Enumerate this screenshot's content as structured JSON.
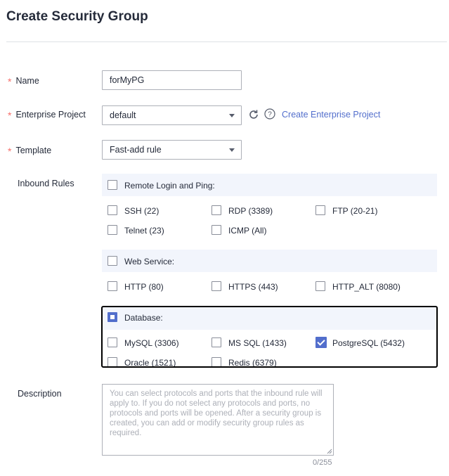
{
  "page": {
    "title": "Create Security Group"
  },
  "form": {
    "name": {
      "label": "Name",
      "value": "forMyPG"
    },
    "enterprise_project": {
      "label": "Enterprise Project",
      "value": "default",
      "create_link": "Create Enterprise Project"
    },
    "template": {
      "label": "Template",
      "value": "Fast-add rule"
    },
    "inbound_rules": {
      "label": "Inbound Rules",
      "remote_login": {
        "header": "Remote Login and Ping:",
        "options": [
          "SSH (22)",
          "RDP (3389)",
          "FTP (20-21)",
          "Telnet (23)",
          "ICMP (All)"
        ]
      },
      "web_service": {
        "header": "Web Service:",
        "options": [
          "HTTP (80)",
          "HTTPS (443)",
          "HTTP_ALT (8080)"
        ]
      },
      "database": {
        "header": "Database:",
        "state": "indeterminate",
        "options": [
          "MySQL (3306)",
          "MS SQL (1433)",
          "PostgreSQL (5432)",
          "Oracle (1521)",
          "Redis (6379)"
        ],
        "checked": [
          "PostgreSQL (5432)"
        ]
      }
    },
    "description": {
      "label": "Description",
      "placeholder": "You can select protocols and ports that the inbound rule will apply to. If you do not select any protocols and ports, no protocols and ports will be opened. After a security group is created, you can add or modify security group rules as required.",
      "counter": "0/255"
    }
  },
  "colors": {
    "required": "#f66f6a",
    "accent": "#526ecc",
    "group_bg": "#f2f5fc"
  },
  "icons": {
    "refresh": "refresh-icon",
    "help": "help-icon",
    "dropdown": "chevron-down-icon"
  }
}
